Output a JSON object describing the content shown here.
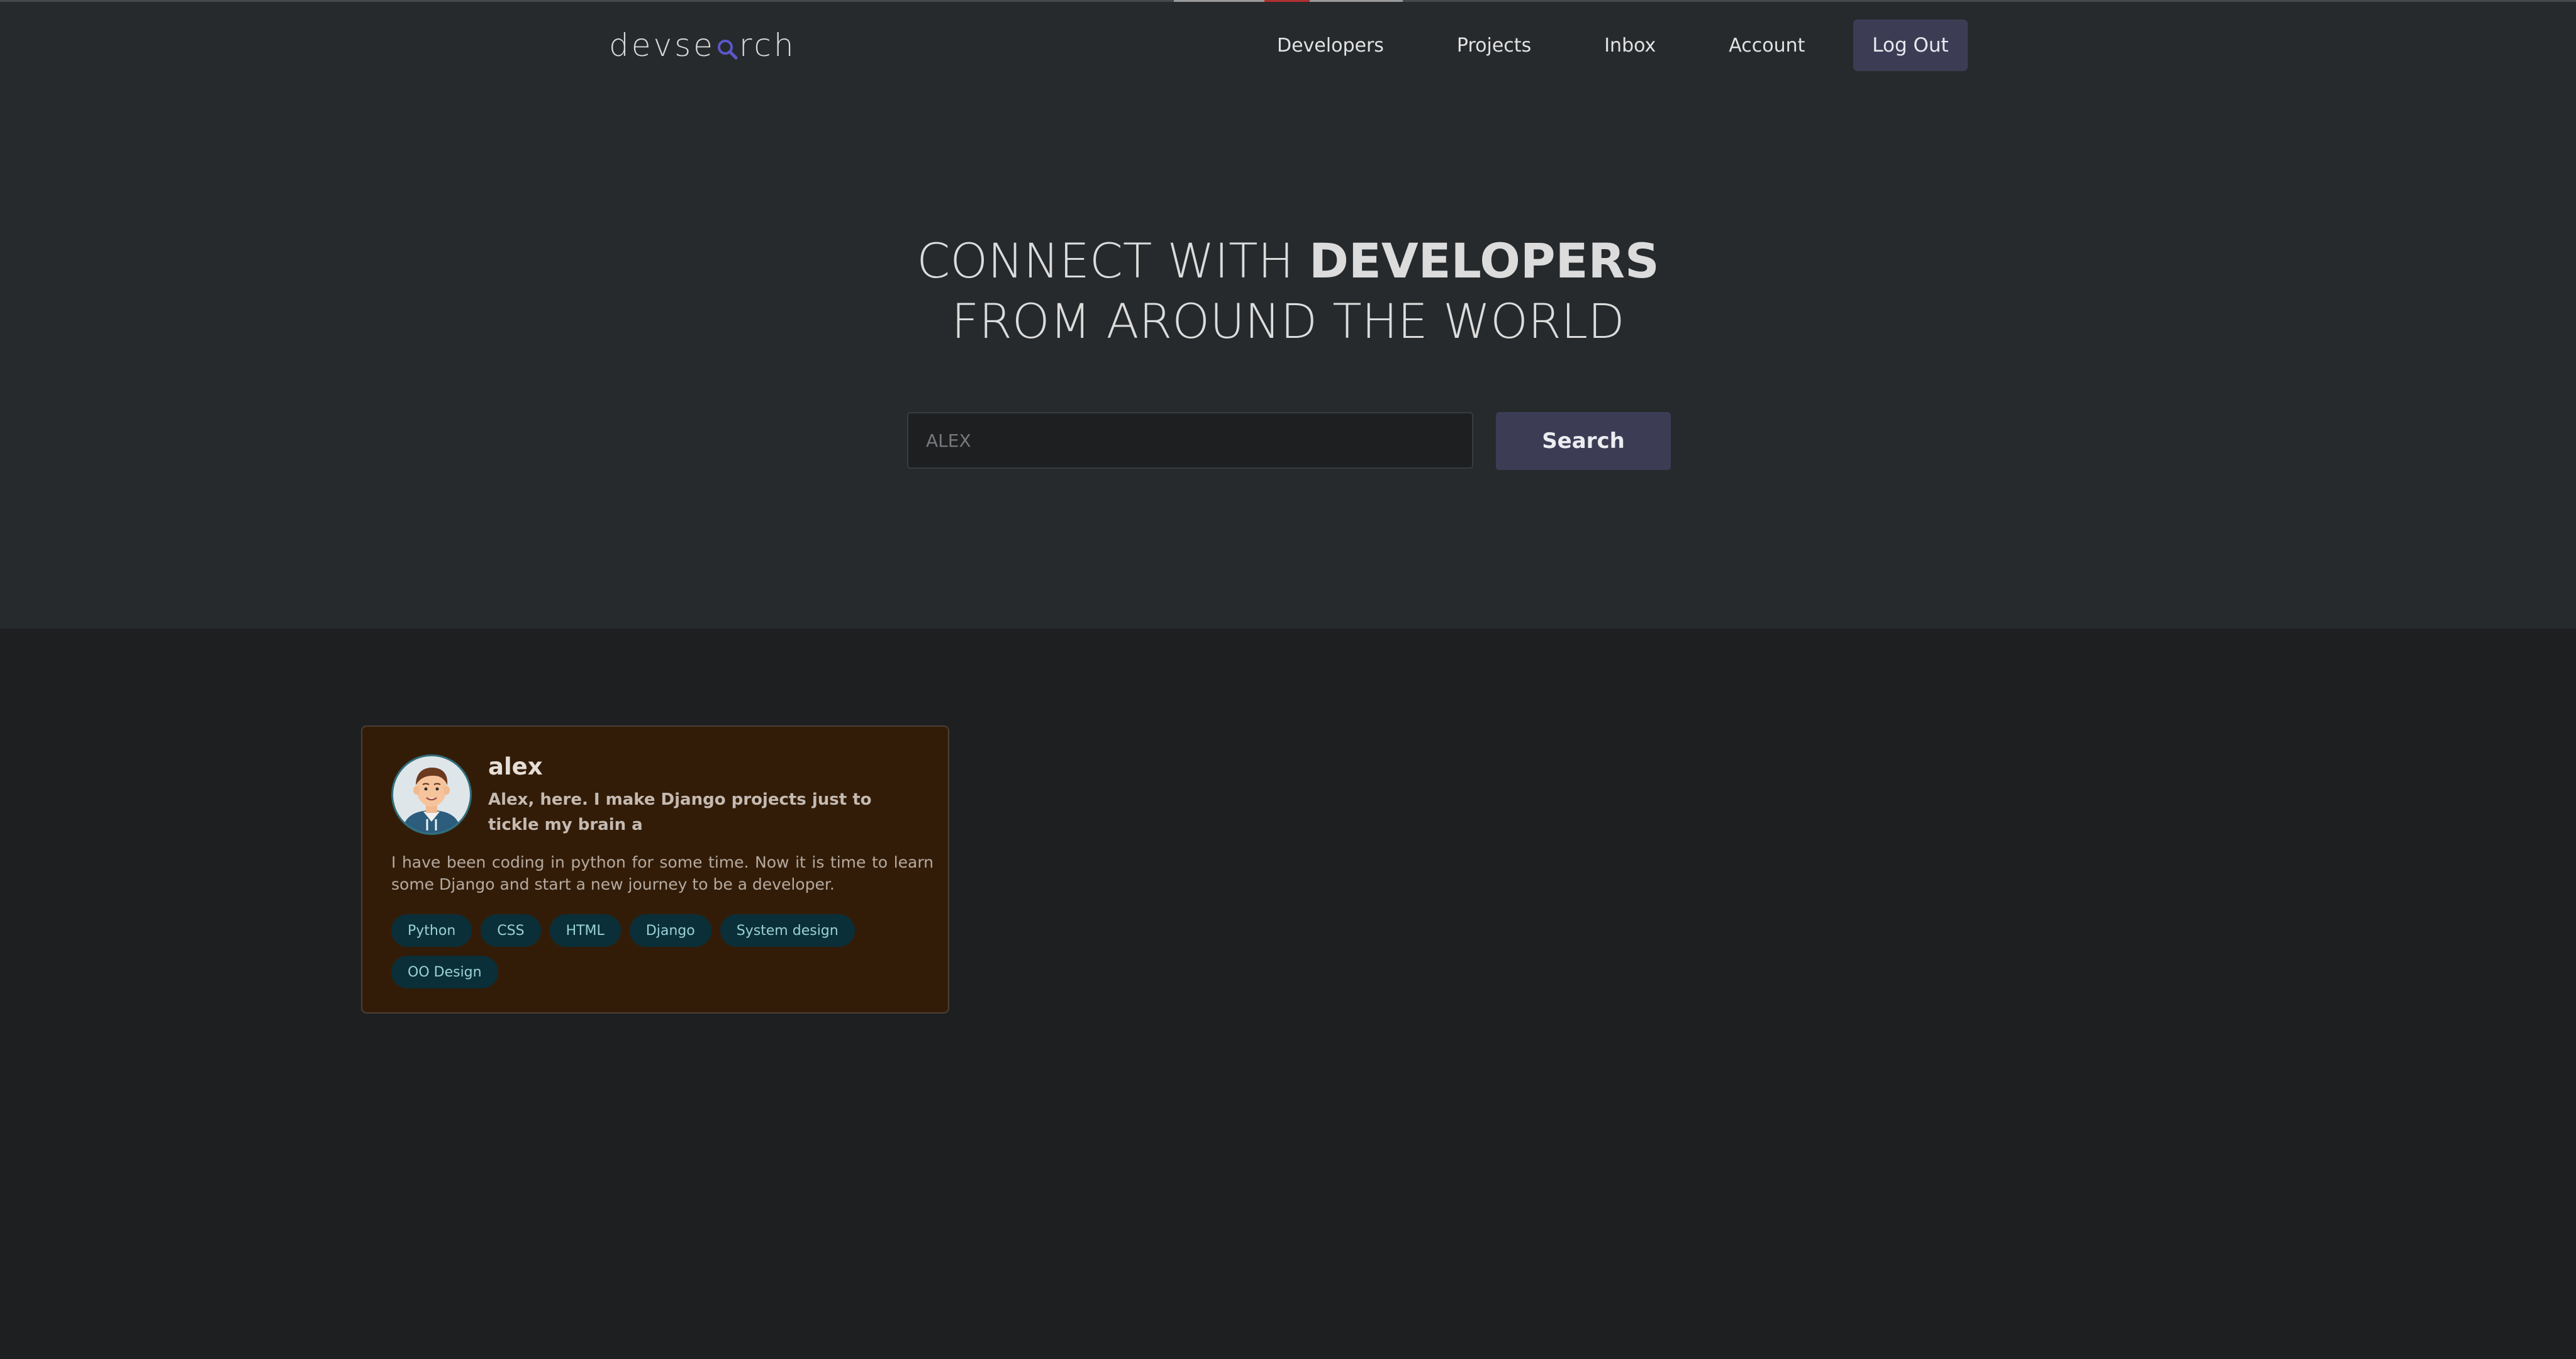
{
  "header": {
    "logo_text_start": "devse",
    "logo_text_end": "rch",
    "nav": [
      "Developers",
      "Projects",
      "Inbox",
      "Account"
    ],
    "logout_label": "Log Out"
  },
  "hero": {
    "title_light_1": "CONNECT WITH ",
    "title_bold": "DEVELOPERS",
    "title_line_2": "FROM AROUND THE WORLD",
    "search_value": "",
    "search_placeholder": "ALEX",
    "search_label": "Search"
  },
  "developers": [
    {
      "name": "alex",
      "headline": "Alex, here. I make Django projects just to tickle my brain a",
      "bio": "I have been coding in python for some time. Now it is time to learn some Django and start a new journey to be a developer.",
      "skills": [
        "Python",
        "CSS",
        "HTML",
        "Django",
        "System design",
        "OO Design"
      ]
    }
  ],
  "colors": {
    "page_bg": "#1e1f21",
    "hero_bg": "#272a2c",
    "button_bg": "#3c3d55",
    "card_bg": "#331c07",
    "tag_bg": "#0a2f39",
    "tag_text": "#9bd0d8",
    "logo_accent": "#5b58c9"
  },
  "icons": {
    "logo_mark": "magnifier-icon",
    "avatar": "developer-avatar"
  }
}
